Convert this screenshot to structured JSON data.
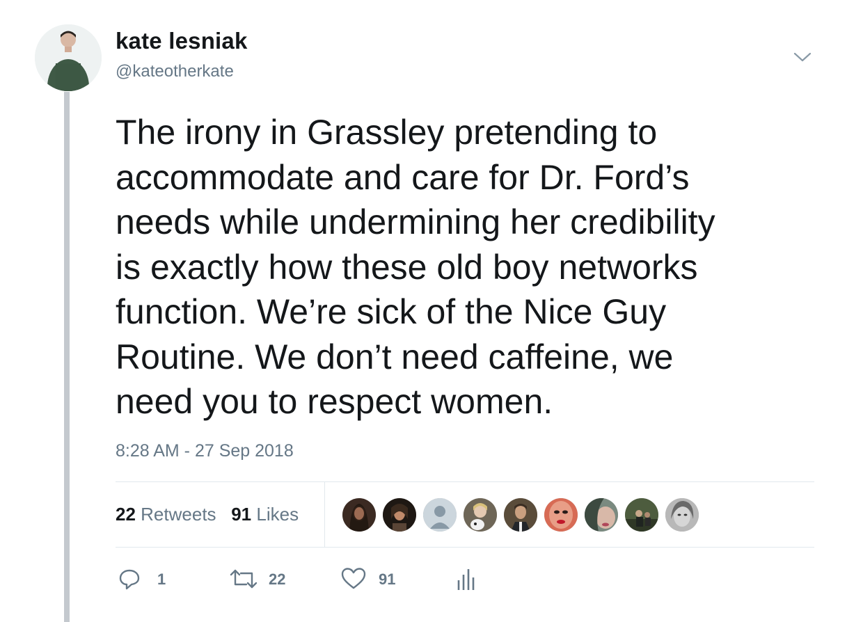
{
  "author": {
    "name": "kate lesniak",
    "handle": "@kateotherkate"
  },
  "tweet": {
    "text": "The irony in Grassley pretending to accommodate and care for Dr. Ford’s needs while undermining her credibility is exactly how these old boy networks function. We’re sick of the Nice Guy Routine. We don’t need caffeine, we need you to respect women.",
    "lines": [
      "The irony in Grassley pretending to",
      "accommodate and care for Dr. Ford’s",
      "needs while undermining her credibility",
      "is exactly how these old boy networks",
      "function. We’re sick of the Nice Guy",
      "Routine. We don’t need caffeine, we",
      "need you to respect women."
    ],
    "timestamp": "8:28 AM - 27 Sep 2018"
  },
  "stats": {
    "retweets_count": "22",
    "retweets_label": "Retweets",
    "likes_count": "91",
    "likes_label": "Likes"
  },
  "likers": [
    {
      "name": "liker-avatar-1",
      "color": "#3b2a22"
    },
    {
      "name": "liker-avatar-2",
      "color": "#2a211c"
    },
    {
      "name": "liker-avatar-3-default",
      "color": "#ccd6dd"
    },
    {
      "name": "liker-avatar-4",
      "color": "#8a7d6c"
    },
    {
      "name": "liker-avatar-5",
      "color": "#4a4033"
    },
    {
      "name": "liker-avatar-6",
      "color": "#c9503a"
    },
    {
      "name": "liker-avatar-7",
      "color": "#6d7c6e"
    },
    {
      "name": "liker-avatar-8",
      "color": "#3d4a35"
    },
    {
      "name": "liker-avatar-9",
      "color": "#9a9a9a"
    }
  ],
  "actions": {
    "reply_count": "1",
    "retweet_count": "22",
    "like_count": "91"
  },
  "colors": {
    "text": "#14171a",
    "secondary": "#657786",
    "divider": "#e1e8ed",
    "thread_line": "#c4c9ce"
  },
  "icons": [
    "chevron-down-icon",
    "reply-icon",
    "retweet-icon",
    "heart-icon",
    "analytics-icon"
  ]
}
